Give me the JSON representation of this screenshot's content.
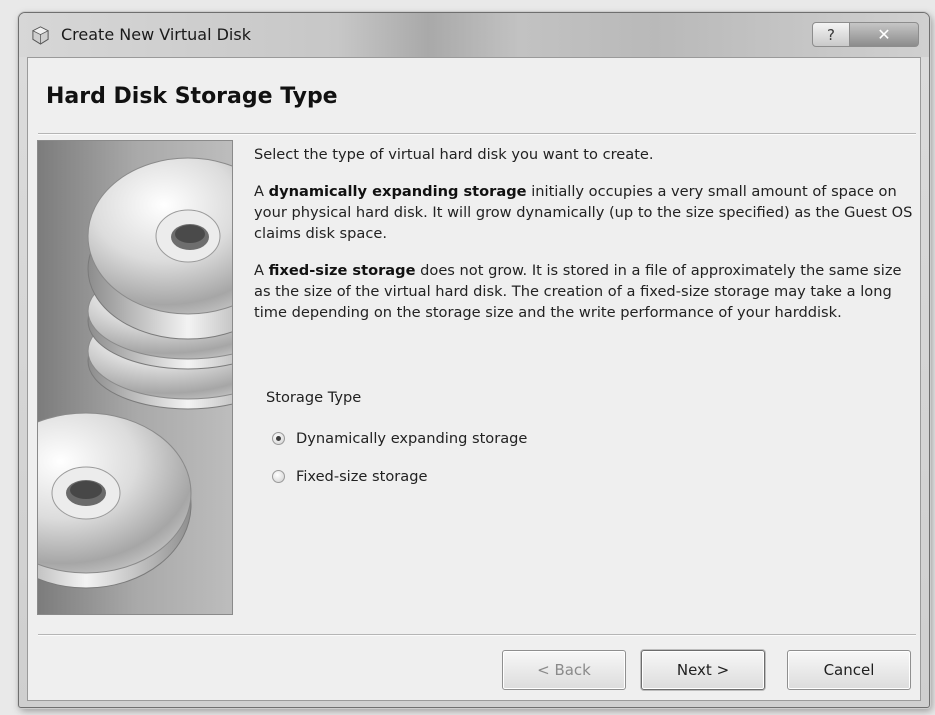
{
  "window": {
    "title": "Create New Virtual Disk",
    "help_glyph": "?",
    "close_glyph": "✕"
  },
  "page": {
    "heading": "Hard Disk Storage Type",
    "intro": "Select the type of virtual hard disk you want to create.",
    "dynamic_prefix": "A ",
    "dynamic_term": "dynamically expanding storage",
    "dynamic_text": " initially occupies a very small amount of space on your physical hard disk. It will grow dynamically (up to the size specified) as the Guest OS claims disk space.",
    "fixed_prefix": "A ",
    "fixed_term": "fixed-size storage",
    "fixed_text": " does not grow. It is stored in a file of approximately the same size as the size of the virtual hard disk. The creation of a fixed-size storage may take a long time depending on the storage size and the write performance of your harddisk."
  },
  "storage_type": {
    "label": "Storage Type",
    "options": [
      {
        "label": "Dynamically expanding storage",
        "checked": true
      },
      {
        "label": "Fixed-size storage",
        "checked": false
      }
    ]
  },
  "buttons": {
    "back": "< Back",
    "next": "Next >",
    "cancel": "Cancel"
  },
  "icons": {
    "app": "virtualbox-cube-icon",
    "side": "stacked-discs-image"
  }
}
